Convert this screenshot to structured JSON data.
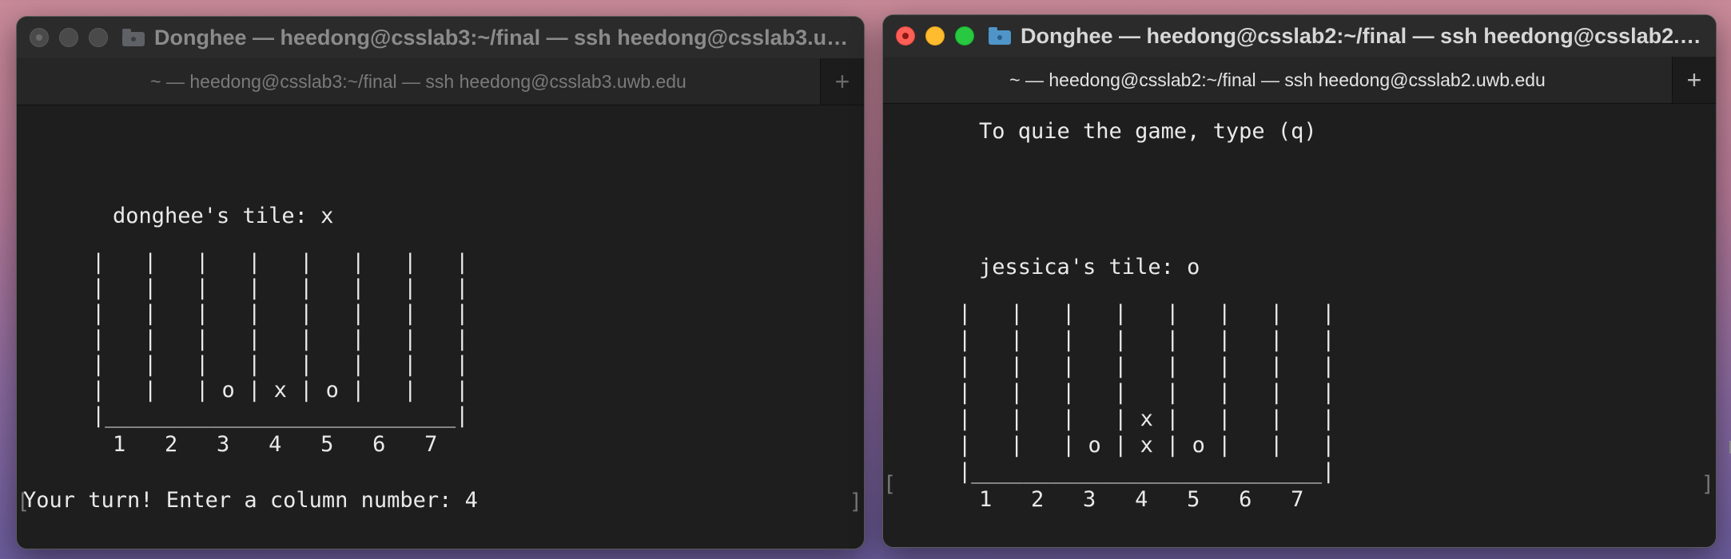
{
  "left_window": {
    "title": "Donghee — heedong@csslab3:~/final — ssh heedong@csslab3.uw...",
    "tab_label": "~ — heedong@csslab3:~/final — ssh heedong@csslab3.uwb.edu",
    "new_tab_label": "+",
    "terminal": {
      "tile_line": "donghee's tile: x",
      "board_rows": [
        "|   |   |   |   |   |   |   |",
        "|   |   |   |   |   |   |   |",
        "|   |   |   |   |   |   |   |",
        "|   |   |   |   |   |   |   |",
        "|   |   |   |   |   |   |   |",
        "|   |   | o | x | o |   |   |",
        "|___________________________|"
      ],
      "column_numbers": "1   2   3   4   5   6   7",
      "prompt_line": "Your turn! Enter a column number: 4"
    }
  },
  "right_window": {
    "title": "Donghee — heedong@csslab2:~/final — ssh heedong@csslab2.u...",
    "tab_label": "~ — heedong@csslab2:~/final — ssh heedong@csslab2.uwb.edu",
    "new_tab_label": "+",
    "terminal": {
      "quit_line": "To quie the game, type (q)",
      "tile_line": "jessica's tile: o",
      "board_rows": [
        "|   |   |   |   |   |   |   |",
        "|   |   |   |   |   |   |   |",
        "|   |   |   |   |   |   |   |",
        "|   |   |   |   |   |   |   |",
        "|   |   |   | x |   |   |   |",
        "|   |   | o | x | o |   |   |",
        "|___________________________|"
      ],
      "column_numbers": "1   2   3   4   5   6   7"
    }
  },
  "icons": {
    "left_title_icon": "folder-icon",
    "right_title_icon": "folder-icon",
    "traffic_lights": [
      "close-icon",
      "minimize-icon",
      "zoom-icon"
    ]
  },
  "colors": {
    "close": "#fe5f57",
    "minimize": "#febc2e",
    "zoom": "#28c840",
    "terminal_bg": "#1e1e1e",
    "terminal_text": "#eaeaea"
  }
}
